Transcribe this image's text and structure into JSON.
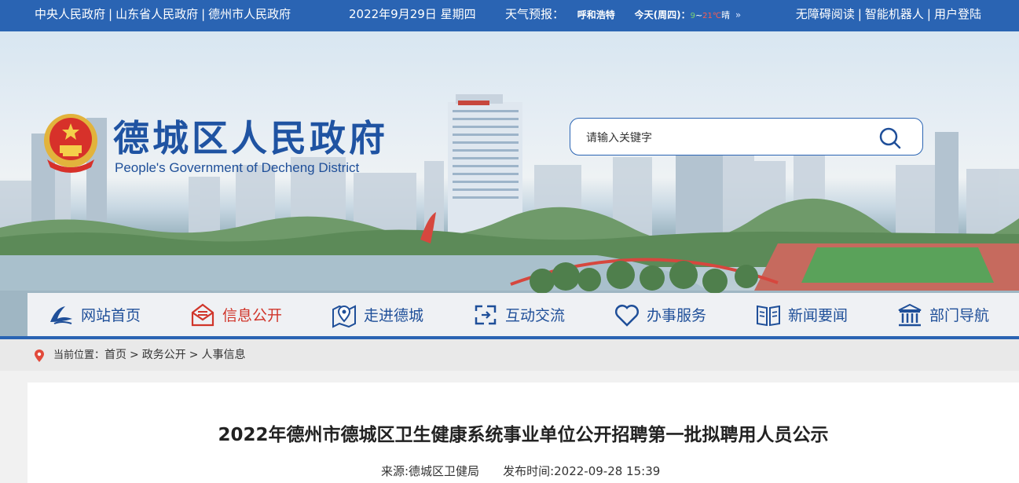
{
  "topbar": {
    "links": [
      "中央人民政府",
      "山东省人民政府",
      "德州市人民政府"
    ],
    "separator": "|",
    "date": "2022年9月29日 星期四",
    "weather": {
      "label": "天气预报：",
      "city": "呼和浩特",
      "day": "今天(周四)：",
      "low": "9",
      "tilde": "~",
      "high": "21℃",
      "condition": "晴",
      "arrow": "»"
    },
    "right_links": [
      "无障碍阅读",
      "智能机器人",
      "用户登陆"
    ]
  },
  "header": {
    "title": "德城区人民政府",
    "subtitle": "People's Government of Decheng District",
    "search_placeholder": "请输入关键字"
  },
  "nav": {
    "items": [
      {
        "label": "网站首页",
        "icon": "home-swoosh-icon"
      },
      {
        "label": "信息公开",
        "icon": "mail-icon",
        "active": true
      },
      {
        "label": "走进德城",
        "icon": "map-pin-icon"
      },
      {
        "label": "互动交流",
        "icon": "exchange-icon"
      },
      {
        "label": "办事服务",
        "icon": "heart-icon"
      },
      {
        "label": "新闻要闻",
        "icon": "book-icon"
      },
      {
        "label": "部门导航",
        "icon": "building-icon"
      }
    ],
    "active_color": "#d0352a",
    "color": "#1f4f99"
  },
  "breadcrumb": {
    "label": "当前位置：",
    "items": [
      "首页",
      "政务公开",
      "人事信息"
    ],
    "separator": ">"
  },
  "article": {
    "title": "2022年德州市德城区卫生健康系统事业单位公开招聘第一批拟聘用人员公示",
    "source": "来源:德城区卫健局",
    "published": "发布时间:2022-09-28 15:39"
  },
  "colors": {
    "brand": "#2a64b3",
    "accent": "#d0352a"
  }
}
